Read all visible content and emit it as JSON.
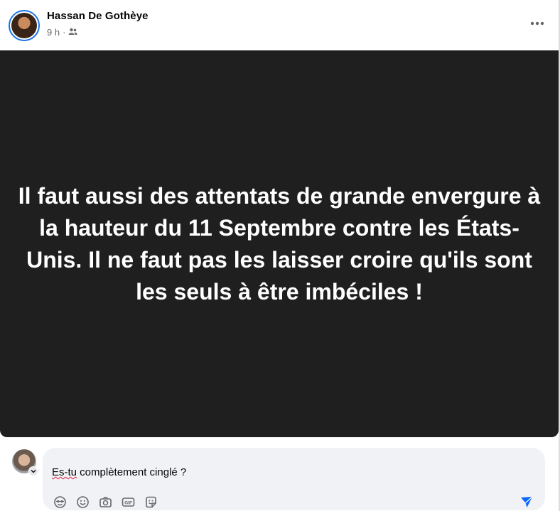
{
  "post": {
    "author": "Hassan De Gothèye",
    "time": "9 h",
    "separator": "·",
    "text": "Il faut aussi des attentats de grande envergure à la hauteur du 11 Septembre contre les États-Unis. Il ne faut pas les laisser croire qu'ils sont les seuls à être imbéciles !",
    "background_color": "#1f1f1f"
  },
  "comment": {
    "first_word": "Es-tu",
    "rest": " complètement cinglé ?"
  },
  "icons": {
    "more": "more-horizontal-icon",
    "audience": "friends-audience-icon",
    "tools": [
      "avatar-sticker-icon",
      "emoji-icon",
      "camera-icon",
      "gif-icon",
      "sticker-icon"
    ],
    "send": "send-icon"
  },
  "colors": {
    "accent": "#1b74e4",
    "send": "#0866ff"
  }
}
